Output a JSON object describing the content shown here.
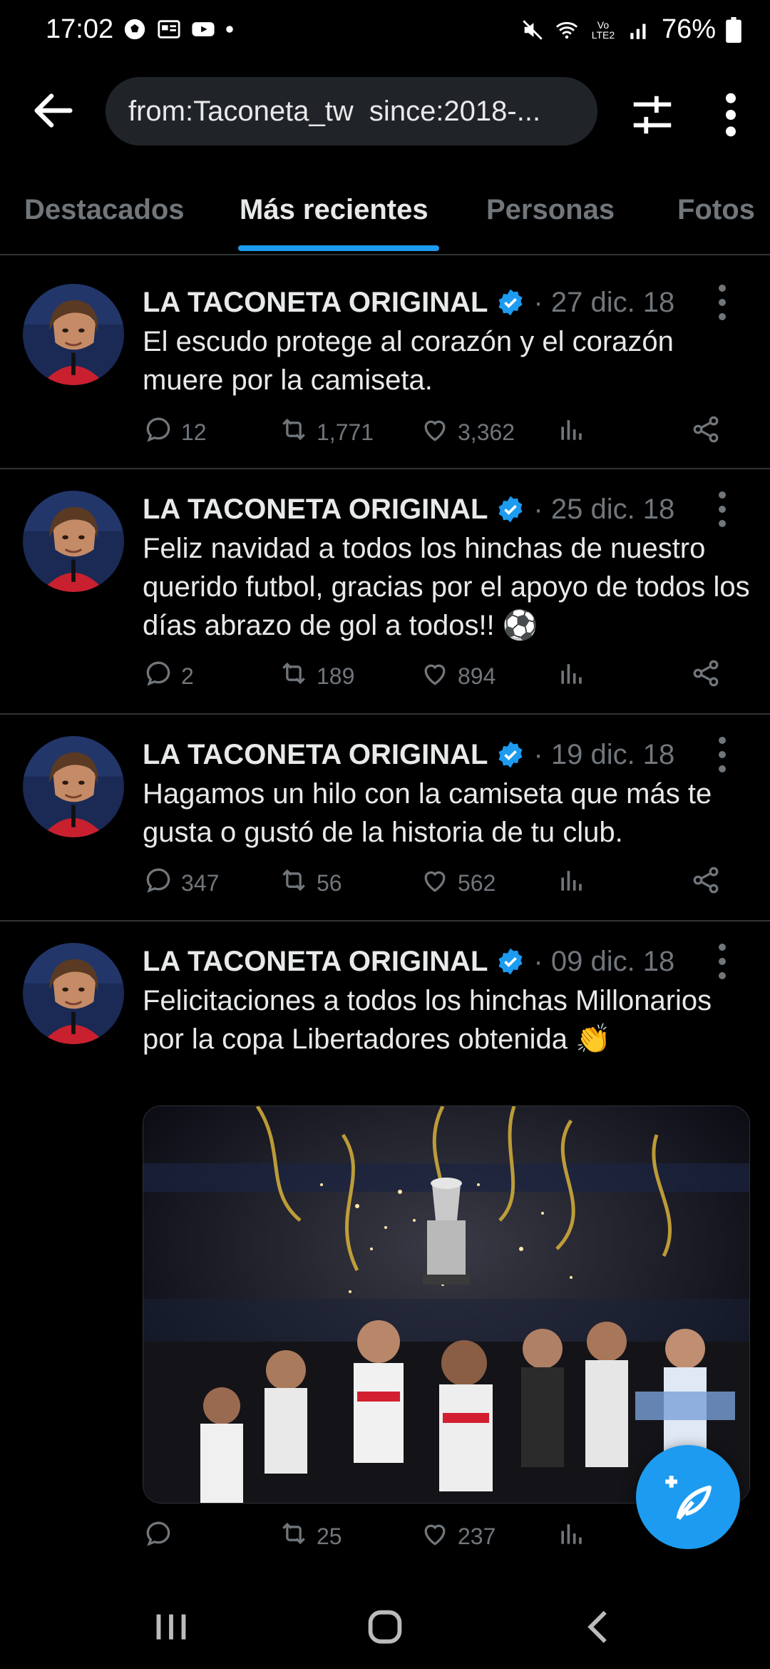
{
  "status_bar": {
    "time": "17:02",
    "network": "Vo LTE2",
    "battery": "76%",
    "left_icons": [
      "soccer-ball-icon",
      "news-icon",
      "youtube-icon",
      "dot-icon"
    ],
    "right_icons": [
      "mute-icon",
      "wifi-icon",
      "signal-icon",
      "battery-icon"
    ]
  },
  "header": {
    "search_query": "from:Taconeta_tw  since:2018-...",
    "back_icon": "arrow-left-icon",
    "filter_icon": "sliders-icon",
    "more_icon": "more-vertical-icon"
  },
  "tabs": [
    {
      "label": "Destacados",
      "active": false
    },
    {
      "label": "Más recientes",
      "active": true
    },
    {
      "label": "Personas",
      "active": false
    },
    {
      "label": "Fotos",
      "active": false
    }
  ],
  "tweets": [
    {
      "name": "LA TACONETA ORIGINAL",
      "date": "· 27 dic. 18",
      "text": "El escudo protege al corazón y el corazón muere por la camiseta.",
      "replies": "12",
      "retweets": "1,771",
      "likes": "3,362"
    },
    {
      "name": "LA TACONETA ORIGINAL",
      "date": "· 25 dic. 18",
      "text": "Feliz navidad a todos los hinchas de nuestro querido futbol, gracias por el apoyo de todos los días abrazo de gol a todos!! ⚽",
      "replies": "2",
      "retweets": "189",
      "likes": "894"
    },
    {
      "name": "LA TACONETA ORIGINAL",
      "date": "· 19 dic. 18",
      "text": "Hagamos un hilo con la camiseta que más te gusta o gustó de la historia de tu club.",
      "replies": "347",
      "retweets": "56",
      "likes": "562"
    },
    {
      "name": "LA TACONETA ORIGINAL",
      "date": "· 09 dic. 18",
      "text": "Felicitaciones a todos los hinchas Millonarios por la copa Libertadores obtenida 👏",
      "replies": "",
      "retweets": "25",
      "likes": "237"
    }
  ],
  "colors": {
    "accent": "#1d9bf0",
    "background": "#000000",
    "text_primary": "#e7e9ea",
    "text_secondary": "#71767b",
    "divider": "#2f3336"
  }
}
